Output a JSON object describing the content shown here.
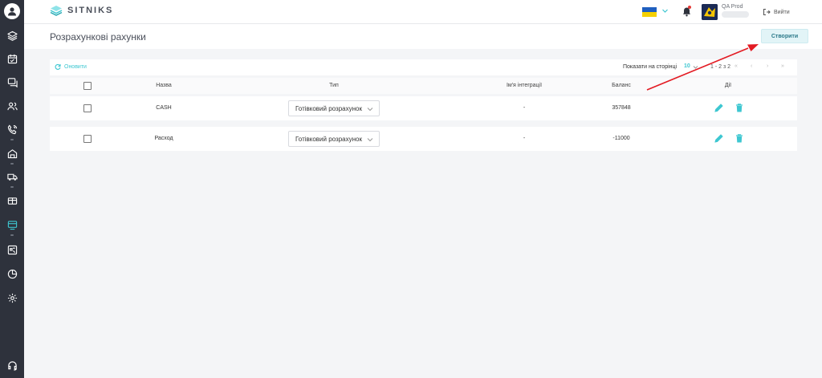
{
  "header": {
    "logo_text": "SITNIKS",
    "user_name": "QA Prod",
    "logout_label": "Вийти"
  },
  "page": {
    "title": "Розрахункові рахунки",
    "create_label": "Створити"
  },
  "toolbar": {
    "refresh_label": "Оновити",
    "per_page_label": "Показати на сторінці",
    "per_page_value": "10",
    "range_label": "1 - 2 з 2"
  },
  "table": {
    "columns": [
      "Назва",
      "Тип",
      "Ім'я інтеграції",
      "Баланс",
      "Дії"
    ],
    "rows": [
      {
        "name": "CASH",
        "type": "Готівковий розрахунок",
        "integration": "-",
        "balance": "357848"
      },
      {
        "name": "Расход",
        "type": "Готівковий розрахунок",
        "integration": "-",
        "balance": "-11000"
      }
    ]
  },
  "colors": {
    "accent": "#3ec7d1",
    "sidebar": "#2e323c",
    "arrow": "#e31b23"
  }
}
